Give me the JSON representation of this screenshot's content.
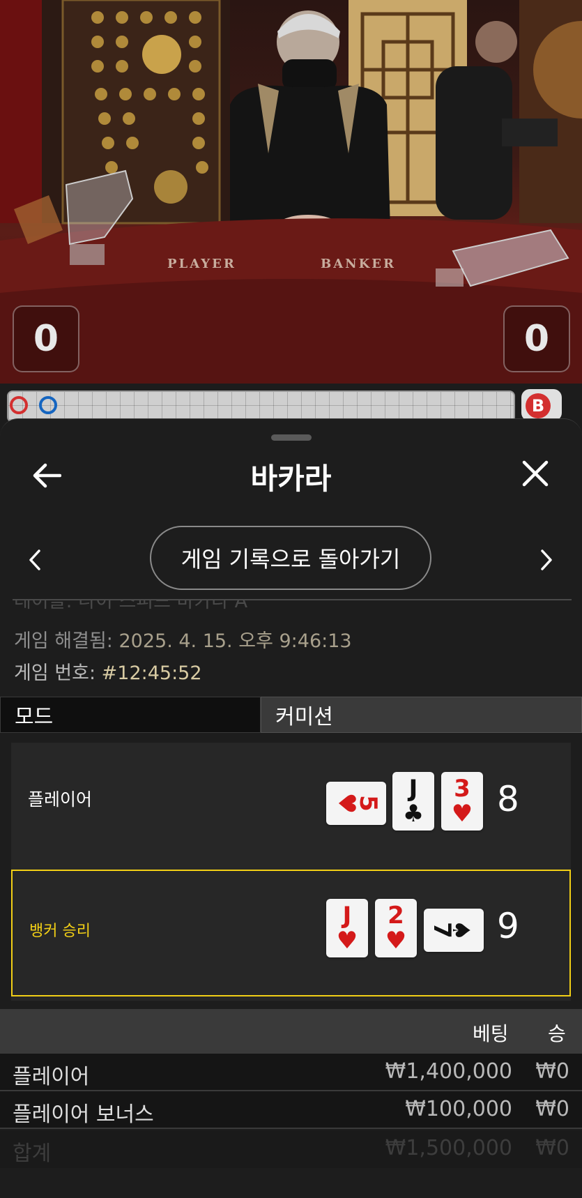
{
  "video": {
    "table_player_label": "PLAYER",
    "table_banker_label": "BANKER",
    "player_score": "0",
    "banker_score": "0",
    "road_badge": "B",
    "colors": {
      "felt": "#5a1d17",
      "banker_red": "#d32f2f",
      "player_blue": "#1565c0"
    }
  },
  "sheet": {
    "title": "바카라",
    "back_icon": "arrow-left-icon",
    "close_icon": "close-x-icon",
    "prev_icon": "chevron-left-icon",
    "next_icon": "chevron-right-icon",
    "back_to_history_label": "게임 기록으로 돌아가기",
    "table_line": "테이블: 나이 스피드 바카라 A",
    "resolved_label": "게임 해결됨:",
    "resolved_value": "2025. 4. 15. 오후 9:46:13",
    "game_no_label": "게임 번호:",
    "game_no_value": "#12:45:52",
    "tabs": [
      {
        "label": "모드"
      },
      {
        "label": "커미션"
      }
    ],
    "result": {
      "player": {
        "label": "플레이어",
        "cards": [
          {
            "rank": "5",
            "suit": "♥",
            "color": "red"
          },
          {
            "rank": "J",
            "suit": "♣",
            "color": "black"
          },
          {
            "rank": "3",
            "suit": "♥",
            "color": "red"
          }
        ],
        "total": "8"
      },
      "banker": {
        "label": "뱅커 승리",
        "cards": [
          {
            "rank": "J",
            "suit": "♥",
            "color": "red"
          },
          {
            "rank": "2",
            "suit": "♥",
            "color": "red"
          },
          {
            "rank": "7",
            "suit": "♠",
            "color": "black"
          }
        ],
        "total": "9",
        "highlight_color": "#f2cf16"
      }
    },
    "bets": {
      "header_bet": "베팅",
      "header_win": "승",
      "rows": [
        {
          "name": "플레이어",
          "bet": "₩1,400,000",
          "win": "₩0"
        },
        {
          "name": "플레이어 보너스",
          "bet": "₩100,000",
          "win": "₩0"
        },
        {
          "name": "합계",
          "bet": "₩1,500,000",
          "win": "₩0"
        }
      ]
    }
  }
}
